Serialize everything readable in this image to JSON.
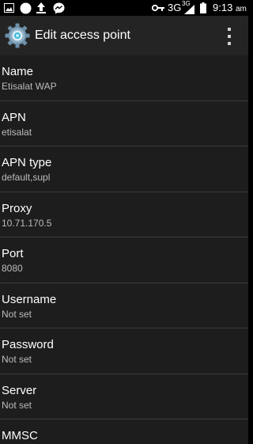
{
  "status_bar": {
    "icons": [
      "image-icon",
      "circle-icon",
      "upload-icon",
      "messenger-icon",
      "key-icon",
      "signal-icon",
      "battery-icon"
    ],
    "network": "3G",
    "network_small": "3G",
    "time": "9:13",
    "ampm": "am"
  },
  "action_bar": {
    "title": "Edit access point",
    "icons": [
      "settings-gear-icon",
      "overflow-menu-icon"
    ]
  },
  "preferences": [
    {
      "title": "Name",
      "summary": "Etisalat WAP"
    },
    {
      "title": "APN",
      "summary": "etisalat"
    },
    {
      "title": "APN type",
      "summary": "default,supl"
    },
    {
      "title": "Proxy",
      "summary": "10.71.170.5"
    },
    {
      "title": "Port",
      "summary": "8080"
    },
    {
      "title": "Username",
      "summary": "Not set"
    },
    {
      "title": "Password",
      "summary": "Not set"
    },
    {
      "title": "Server",
      "summary": "Not set"
    },
    {
      "title": "MMSC",
      "summary": ""
    }
  ]
}
